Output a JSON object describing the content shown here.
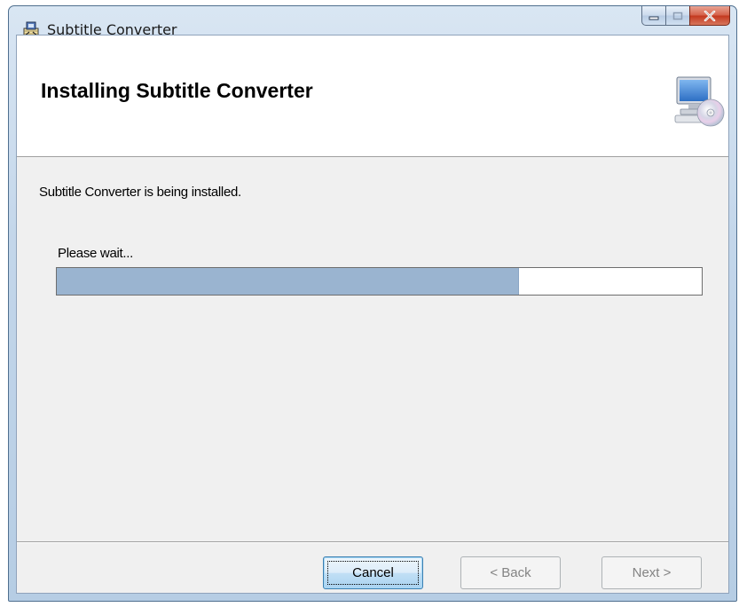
{
  "window": {
    "title": "Subtitle Converter",
    "icon": "installer-app-icon",
    "caption_buttons": [
      "minimize",
      "maximize",
      "close"
    ],
    "close_glyph": "x"
  },
  "banner": {
    "title": "Installing Subtitle Converter",
    "icon": "computer-cd-icon"
  },
  "body": {
    "status": "Subtitle Converter is being installed.",
    "wait_label": "Please wait...",
    "progress_fraction": 0.715
  },
  "buttons": {
    "cancel": "Cancel",
    "back": "< Back",
    "next": "Next >"
  },
  "colors": {
    "progress_fill": "#9ab4d0",
    "close_button": "#c4381f",
    "default_button_border": "#3c7fb1"
  }
}
